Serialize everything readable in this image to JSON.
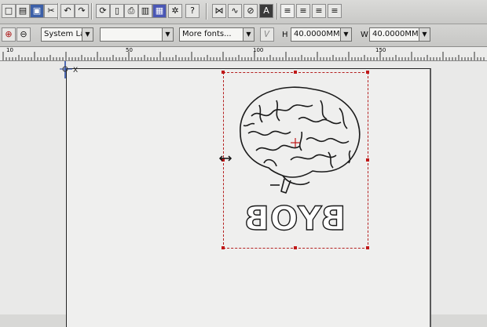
{
  "toolbar2": {
    "system_combo": "System Lan",
    "style_combo": "",
    "font_combo": "More fonts...",
    "height_label": "H",
    "height_value": "40.0000MM",
    "width_label": "W",
    "width_value": "40.0000MM"
  },
  "canvas": {
    "origin_label": "X",
    "artwork_text": "BYOB"
  },
  "ruler": {
    "ticks": [
      "10",
      "50",
      "100",
      "150"
    ]
  }
}
